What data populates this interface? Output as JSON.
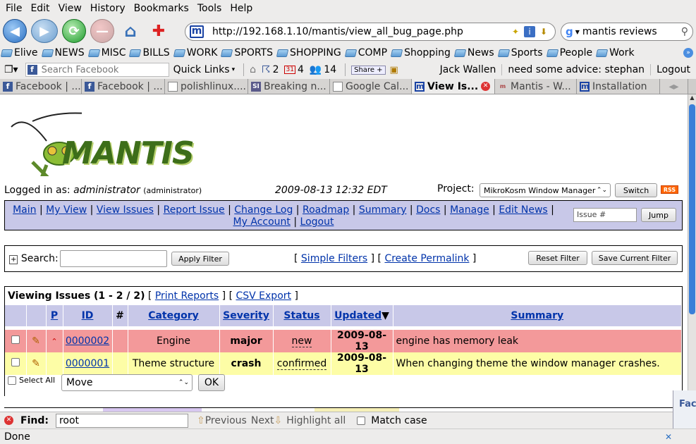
{
  "browser": {
    "menu": [
      "File",
      "Edit",
      "View",
      "History",
      "Bookmarks",
      "Tools",
      "Help"
    ],
    "url": "http://192.168.1.10/mantis/view_all_bug_page.php",
    "search_value": "mantis reviews",
    "bookmarks": [
      "Elive",
      "NEWS",
      "MISC",
      "BILLS",
      "WORK",
      "SPORTS",
      "SHOPPING",
      "COMP",
      "Shopping",
      "News",
      "Sports",
      "People",
      "Work"
    ],
    "fb_search_placeholder": "Search Facebook",
    "quick_links": "Quick Links",
    "count_pokes": "2",
    "count_events": "4",
    "count_friends": "14",
    "share_label": "Share",
    "user_name": "Jack Wallen",
    "status_text": "need some advice: stephan",
    "logout": "Logout",
    "tabs": [
      "Facebook | ...",
      "Facebook | ...",
      "polishlinux....",
      "Breaking n...",
      "Google Cal...",
      "View Is...",
      "Mantis - W...",
      "Installation"
    ],
    "find_label": "Find:",
    "find_value": "root",
    "find_previous": "Previous",
    "find_next": "Next",
    "find_highlight": "Highlight all",
    "find_match_case": "Match case",
    "status": "Done",
    "fb_peek": "Fac"
  },
  "page": {
    "logo_text": "MANTIS",
    "logged_in_prefix": "Logged in as:",
    "user": "administrator",
    "user_role": "(administrator)",
    "datetime": "2009-08-13 12:32 EDT",
    "project_label": "Project:",
    "project_selected": "MikroKosm Window Manager",
    "switch_label": "Switch",
    "rss": "RSS",
    "nav": [
      "Main",
      "My View",
      "View Issues",
      "Report Issue",
      "Change Log",
      "Roadmap",
      "Summary",
      "Docs",
      "Manage",
      "Edit News",
      "My Account",
      "Logout"
    ],
    "issue_placeholder": "Issue #",
    "jump_label": "Jump",
    "search_label": "Search:",
    "apply_filter": "Apply Filter",
    "simple_filters": "Simple Filters",
    "create_permalink": "Create Permalink",
    "reset_filter": "Reset Filter",
    "save_filter": "Save Current Filter",
    "viewing_title": "Viewing Issues (1 - 2 / 2)",
    "print_reports": "Print Reports",
    "csv_export": "CSV Export",
    "columns": [
      "P",
      "ID",
      "#",
      "Category",
      "Severity",
      "Status",
      "Updated",
      "Summary"
    ],
    "issues": [
      {
        "id": "0000002",
        "category": "Engine",
        "severity": "major",
        "status": "new",
        "updated": "2009-08-13",
        "summary": "engine has memory leak"
      },
      {
        "id": "0000001",
        "category": "Theme structure",
        "severity": "crash",
        "status": "confirmed",
        "updated": "2009-08-13",
        "summary": "When changing theme the window manager crashes."
      }
    ],
    "select_all": "Select All",
    "move_value": "Move",
    "ok_label": "OK"
  }
}
